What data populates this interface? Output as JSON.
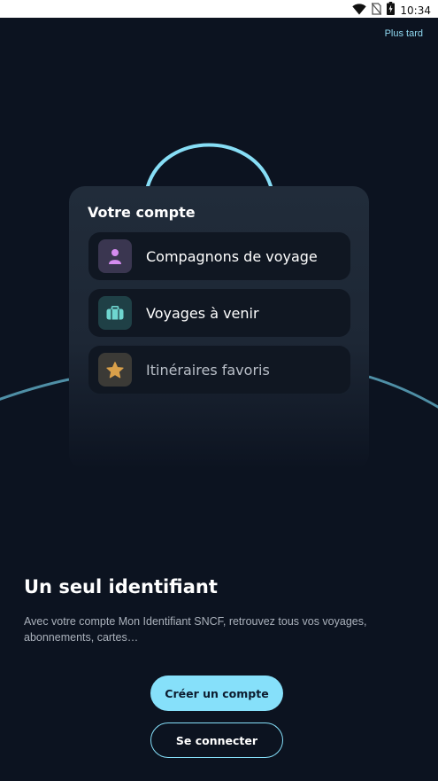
{
  "status_bar": {
    "time": "10:34",
    "icons": [
      "wifi-icon",
      "no-sim-icon",
      "battery-charging-icon"
    ]
  },
  "header": {
    "later_label": "Plus tard"
  },
  "card": {
    "title": "Votre compte",
    "items": [
      {
        "label": "Compagnons de voyage",
        "icon": "person-icon",
        "icon_color": "#d58cf0",
        "icon_bg": "#3a3650"
      },
      {
        "label": "Voyages à venir",
        "icon": "suitcase-icon",
        "icon_color": "#6fd6d0",
        "icon_bg": "#1f4046"
      },
      {
        "label": "Itinéraires favoris",
        "icon": "star-icon",
        "icon_color": "#d9a04a",
        "icon_bg": "#3b3a36"
      }
    ]
  },
  "onboarding": {
    "title": "Un seul identifiant",
    "description": "Avec votre compte Mon Identifiant SNCF, retrouvez tous vos voyages, abonnements, cartes…"
  },
  "actions": {
    "create_account_label": "Créer un compte",
    "login_label": "Se connecter"
  },
  "colors": {
    "background": "#0c1320",
    "accent": "#86e0fa",
    "card": "#212c3a"
  }
}
